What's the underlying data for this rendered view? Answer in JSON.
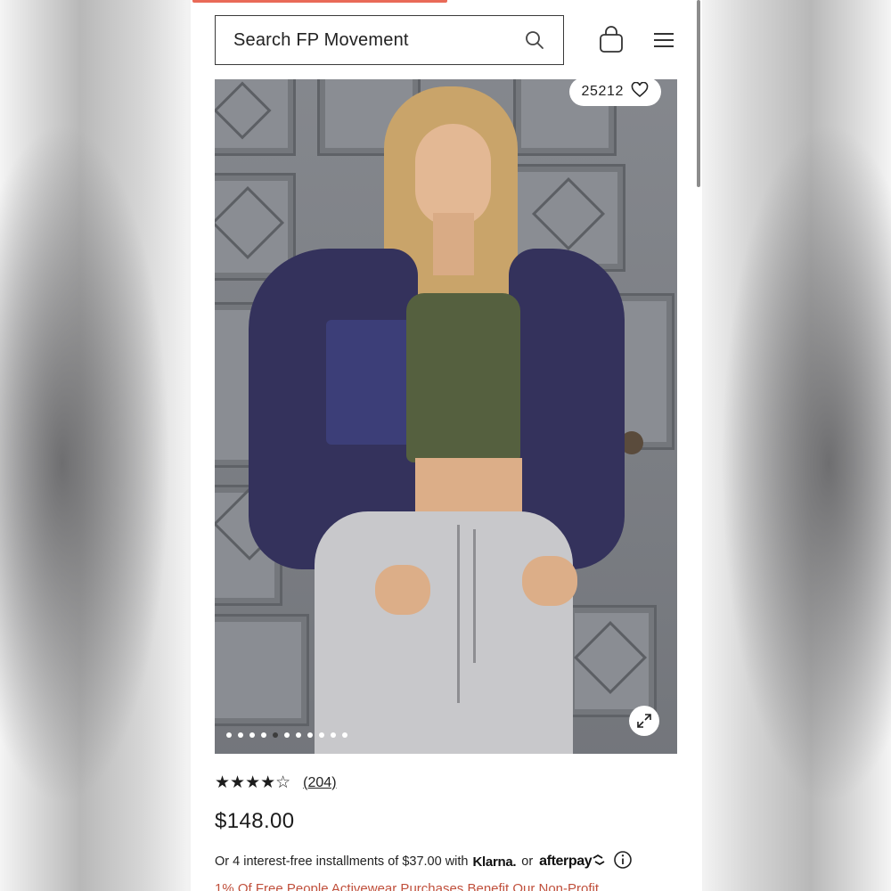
{
  "header": {
    "search_placeholder": "Search FP Movement",
    "icons": [
      "search-icon",
      "shopping-bag-icon",
      "hamburger-menu-icon"
    ]
  },
  "product": {
    "wishlist_count": "25212",
    "image_dots_total": 11,
    "image_dots_active": 5,
    "rating_stars": "★★★★☆",
    "rating_value": 4.5,
    "review_count": "(204)",
    "price": "$148.00",
    "installments": {
      "prefix": "Or 4 interest-free installments of $37.00 with",
      "klarna": "Klarna.",
      "or": "or",
      "afterpay": "afterpay"
    },
    "promo_text": "1% Of Free People Activewear Purchases Benefit Our Non-Profit"
  },
  "colors": {
    "accent": "#e96a58",
    "promo": "#c0503c",
    "text": "#222222"
  }
}
